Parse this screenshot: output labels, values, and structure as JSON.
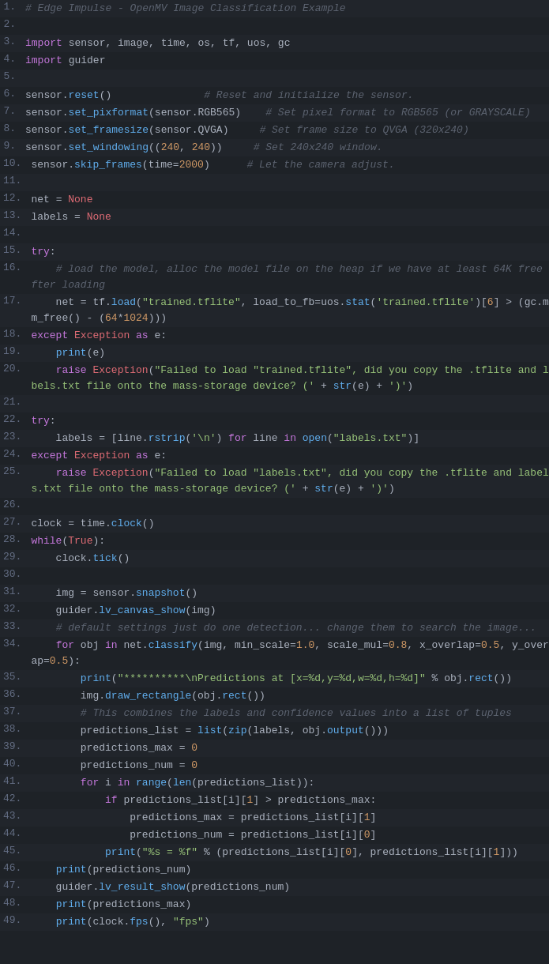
{
  "title": "Edge Impulse - OpenMV Image Classification Example",
  "lines": [
    {
      "num": 1,
      "content": "comment_line1"
    },
    {
      "num": 2,
      "content": "blank"
    },
    {
      "num": 3,
      "content": "import_line1"
    },
    {
      "num": 4,
      "content": "import_line2"
    },
    {
      "num": 5,
      "content": "blank"
    },
    {
      "num": 6,
      "content": "sensor_reset"
    },
    {
      "num": 7,
      "content": "sensor_pix"
    },
    {
      "num": 8,
      "content": "sensor_frame"
    },
    {
      "num": 9,
      "content": "sensor_window"
    },
    {
      "num": 10,
      "content": "sensor_skip"
    },
    {
      "num": 11,
      "content": "blank"
    },
    {
      "num": 12,
      "content": "net_none"
    },
    {
      "num": 13,
      "content": "labels_none"
    },
    {
      "num": 14,
      "content": "blank"
    },
    {
      "num": 15,
      "content": "try1"
    },
    {
      "num": 16,
      "content": "load_comment"
    },
    {
      "num": 17,
      "content": "net_assign"
    },
    {
      "num": 18,
      "content": "except1"
    },
    {
      "num": 19,
      "content": "print_e"
    },
    {
      "num": 20,
      "content": "raise1"
    },
    {
      "num": 21,
      "content": "blank"
    },
    {
      "num": 22,
      "content": "try2"
    },
    {
      "num": 23,
      "content": "labels_assign"
    },
    {
      "num": 24,
      "content": "except2"
    },
    {
      "num": 25,
      "content": "raise2"
    },
    {
      "num": 26,
      "content": "blank"
    },
    {
      "num": 27,
      "content": "clock_assign"
    },
    {
      "num": 28,
      "content": "while_true"
    },
    {
      "num": 29,
      "content": "clock_tick"
    },
    {
      "num": 30,
      "content": "blank"
    },
    {
      "num": 31,
      "content": "img_assign"
    },
    {
      "num": 32,
      "content": "guider_canvas"
    },
    {
      "num": 33,
      "content": "default_comment"
    },
    {
      "num": 34,
      "content": "for_obj"
    },
    {
      "num": 35,
      "content": "print_pred"
    },
    {
      "num": 36,
      "content": "img_draw"
    },
    {
      "num": 37,
      "content": "combine_comment"
    },
    {
      "num": 38,
      "content": "pred_list"
    },
    {
      "num": 39,
      "content": "pred_max"
    },
    {
      "num": 40,
      "content": "pred_num"
    },
    {
      "num": 41,
      "content": "for_i"
    },
    {
      "num": 42,
      "content": "if_pred"
    },
    {
      "num": 43,
      "content": "pred_max_assign"
    },
    {
      "num": 44,
      "content": "pred_num_assign"
    },
    {
      "num": 45,
      "content": "print_percent"
    },
    {
      "num": 46,
      "content": "print_pred_num"
    },
    {
      "num": 47,
      "content": "guider_result"
    },
    {
      "num": 48,
      "content": "print_pred_max"
    },
    {
      "num": 49,
      "content": "print_clock"
    }
  ]
}
